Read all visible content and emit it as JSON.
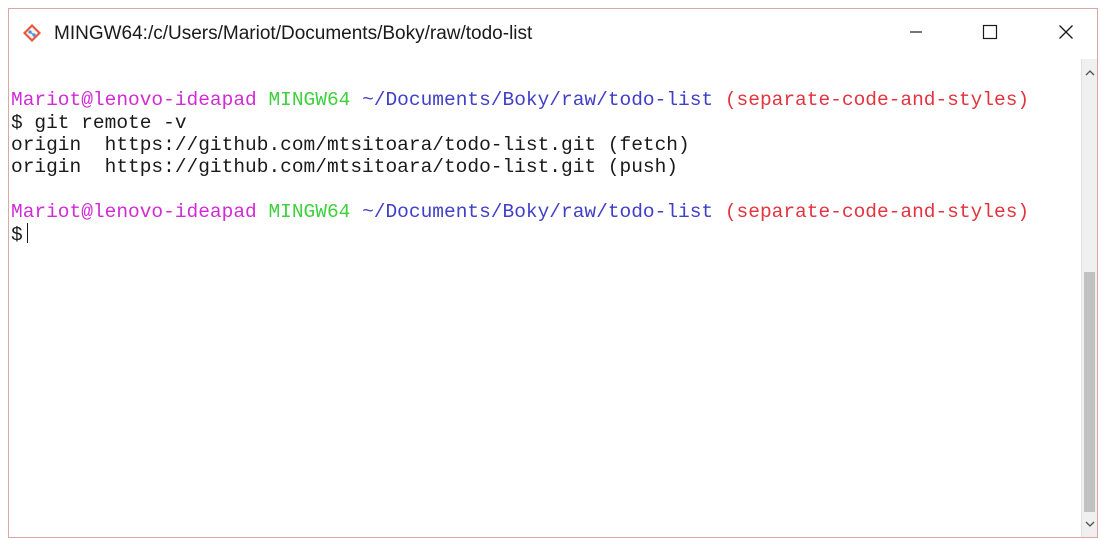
{
  "window": {
    "title": "MINGW64:/c/Users/Mariot/Documents/Boky/raw/todo-list",
    "icon": "git-bash-icon",
    "controls": {
      "minimize": "minimize-icon",
      "maximize": "maximize-icon",
      "close": "close-icon"
    }
  },
  "terminal": {
    "prompt1": {
      "user": "Mariot@lenovo-ideapad",
      "host": "MINGW64",
      "path": "~/Documents/Boky/raw/todo-list",
      "branch": "(separate-code-and-styles)"
    },
    "command": "$ git remote -v",
    "output": [
      "origin  https://github.com/mtsitoara/todo-list.git (fetch)",
      "origin  https://github.com/mtsitoara/todo-list.git (push)"
    ],
    "prompt2": {
      "user": "Mariot@lenovo-ideapad",
      "host": "MINGW64",
      "path": "~/Documents/Boky/raw/todo-list",
      "branch": "(separate-code-and-styles)"
    },
    "input_prompt": "$"
  },
  "colors": {
    "user": "#d12bd6",
    "host": "#3ed13e",
    "path": "#3f3fc9",
    "branch": "#e2333e",
    "text": "#1a1a1a",
    "window_border": "#d9a8a0"
  }
}
